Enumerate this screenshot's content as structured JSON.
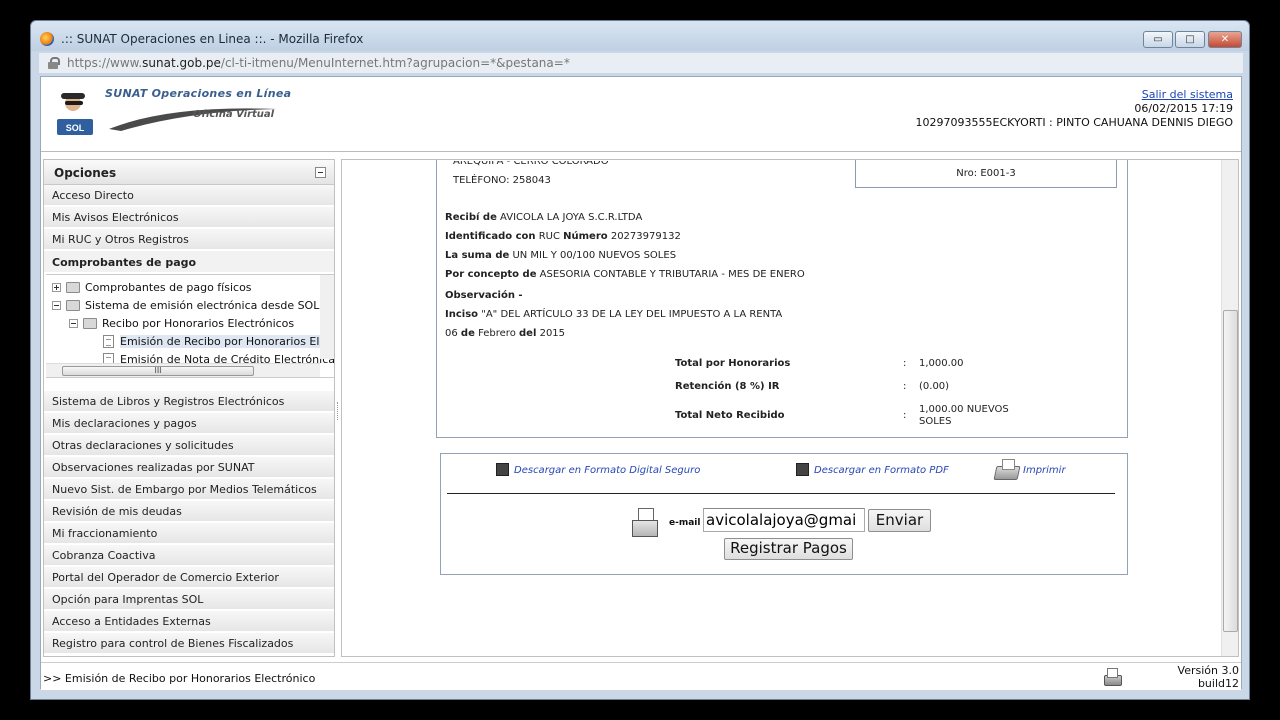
{
  "window": {
    "title": ".:: SUNAT Operaciones en Linea ::. - Mozilla Firefox",
    "controls": {
      "minimize": "▭",
      "maximize": "□",
      "close": "✕"
    }
  },
  "address": {
    "prefix": "https://www.",
    "domain": "sunat.gob.pe",
    "path": "/cl-ti-itmenu/MenuInternet.htm?agrupacion=*&pestana=*"
  },
  "header": {
    "logo_title": "SUNAT Operaciones en Línea",
    "logo_subtitle": "Oficina Virtual",
    "logo_badge": "SOL",
    "logout": "Salir del sistema",
    "datetime": "06/02/2015 17:19",
    "user": "10297093555ECKYORTI : PINTO CAHUANA DENNIS DIEGO"
  },
  "sidebar": {
    "title": "Opciones",
    "top_items": [
      "Acceso Directo",
      "Mis Avisos Electrónicos",
      "Mi RUC y Otros Registros",
      "Comprobantes de pago"
    ],
    "tree": [
      "Comprobantes de pago físicos",
      "Sistema de emisión electrónica desde SOL",
      "Recibo por Honorarios Electrónicos",
      "Emisión de Recibo por Honorarios Electró",
      "Emisión de Nota de Crédito Electrónica"
    ],
    "tree_hscroll_grip": "III",
    "bottom_items": [
      "Sistema de Libros y Registros Electrónicos",
      "Mis declaraciones y pagos",
      "Otras declaraciones y solicitudes",
      "Observaciones realizadas por SUNAT",
      "Nuevo Sist. de Embargo por Medios Telemáticos",
      "Revisión de mis deudas",
      "Mi fraccionamiento",
      "Cobranza Coactiva",
      "Portal del Operador de Comercio Exterior",
      "Opción para Imprentas SOL",
      "Acceso a Entidades Externas",
      "Registro para control de Bienes Fiscalizados"
    ]
  },
  "receipt": {
    "partial_top": "AREQUIPA - CERRO COLORADO",
    "telefono": "TELÉFONO: 258043",
    "nro": "Nro: E001-3",
    "recibi_lbl": "Recibí de",
    "recibi_val": "AVICOLA LA JOYA S.C.R.LTDA",
    "ident_lbl1": "Identificado con",
    "ident_mid": "RUC",
    "ident_lbl2": "Número",
    "ident_val": "20273979132",
    "suma_lbl": "La suma de",
    "suma_val": "UN MIL Y 00/100 NUEVOS SOLES",
    "concepto_lbl": "Por concepto de",
    "concepto_val": "ASESORIA CONTABLE Y TRIBUTARIA - MES DE ENERO",
    "observ_lbl": "Observación -",
    "inciso_lbl": "Inciso",
    "inciso_val": "\"A\" DEL ARTÍCULO 33 DE LA LEY DEL IMPUESTO A LA RENTA",
    "fecha_d": "06",
    "fecha_de1": "de",
    "fecha_m": "Febrero",
    "fecha_de2": "del",
    "fecha_y": "2015",
    "totals": [
      {
        "label": "Total por Honorarios",
        "sep": ":",
        "value": "1,000.00"
      },
      {
        "label": "Retención (8 %) IR",
        "sep": ":",
        "value": "(0.00)"
      },
      {
        "label": "Total Neto Recibido",
        "sep": ":",
        "value": "1,000.00 NUEVOS",
        "value2": "SOLES"
      }
    ]
  },
  "actions": {
    "download_secure": "Descargar en Formato Digital Seguro",
    "download_pdf": "Descargar en Formato PDF",
    "print": "Imprimir",
    "email_label": "e-mail",
    "email_value": "avicolalajoya@gmai",
    "send": "Enviar",
    "register": "Registrar Pagos"
  },
  "status": {
    "breadcrumb": ">> Emisión de Recibo por Honorarios Electrónico",
    "version": "Versión 3.0",
    "build": "build12"
  }
}
